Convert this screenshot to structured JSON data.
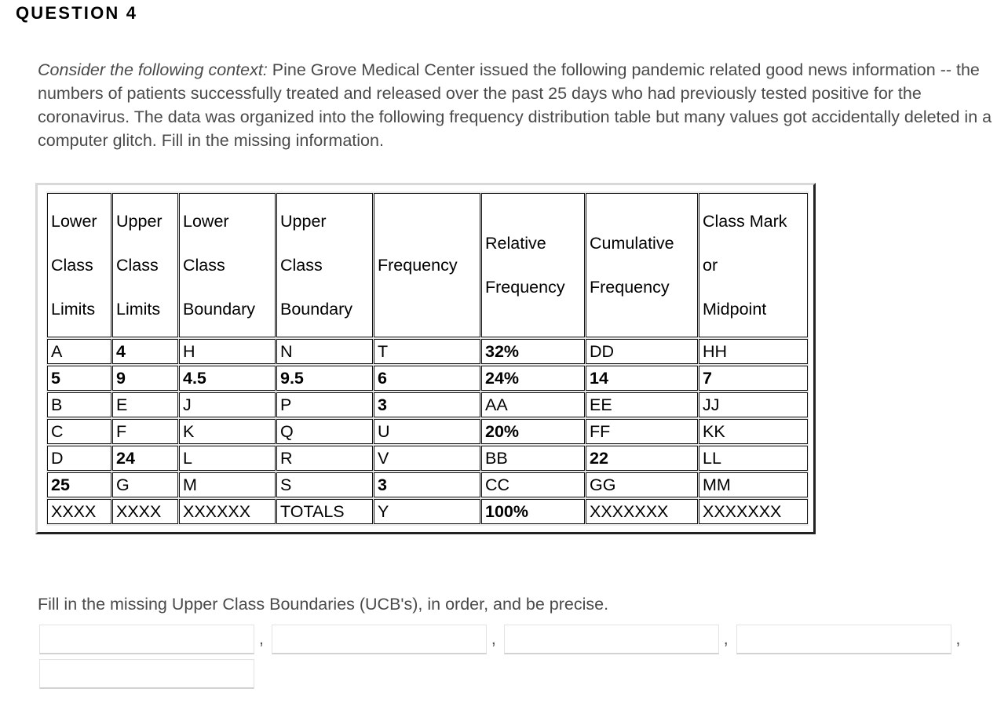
{
  "heading": "QUESTION 4",
  "context": {
    "lead": "Consider the following context:",
    "body": " Pine Grove Medical Center issued the following pandemic related good news information -- the numbers of patients successfully treated and released over the past 25 days who had previously tested positive for the coronavirus.  The data was organized into the following frequency distribution table but many values got accidentally deleted in a computer glitch.  Fill in the missing information."
  },
  "table": {
    "headers": [
      {
        "lines": [
          "Lower",
          "Class",
          "Limits"
        ]
      },
      {
        "lines": [
          "Upper",
          "Class",
          "Limits"
        ]
      },
      {
        "lines": [
          "Lower",
          "Class",
          "Boundary"
        ]
      },
      {
        "lines": [
          "Upper",
          "Class",
          "Boundary"
        ]
      },
      {
        "lines": [
          "Frequency"
        ]
      },
      {
        "lines": [
          "Relative",
          "Frequency"
        ]
      },
      {
        "lines": [
          "Cumulative",
          "Frequency"
        ]
      },
      {
        "lines": [
          "Class Mark",
          "or",
          "Midpoint"
        ]
      }
    ],
    "rows": [
      [
        {
          "v": "A",
          "bold": false
        },
        {
          "v": "4",
          "bold": true
        },
        {
          "v": "H",
          "bold": false
        },
        {
          "v": "N",
          "bold": false
        },
        {
          "v": "T",
          "bold": false
        },
        {
          "v": "32%",
          "bold": true
        },
        {
          "v": "DD",
          "bold": false
        },
        {
          "v": "HH",
          "bold": false
        }
      ],
      [
        {
          "v": "5",
          "bold": true
        },
        {
          "v": "9",
          "bold": true
        },
        {
          "v": "4.5",
          "bold": true
        },
        {
          "v": "9.5",
          "bold": true
        },
        {
          "v": "6",
          "bold": true
        },
        {
          "v": "24%",
          "bold": true
        },
        {
          "v": "14",
          "bold": true
        },
        {
          "v": "7",
          "bold": true
        }
      ],
      [
        {
          "v": "B",
          "bold": false
        },
        {
          "v": "E",
          "bold": false
        },
        {
          "v": "J",
          "bold": false
        },
        {
          "v": "P",
          "bold": false
        },
        {
          "v": "3",
          "bold": true
        },
        {
          "v": "AA",
          "bold": false
        },
        {
          "v": "EE",
          "bold": false
        },
        {
          "v": "JJ",
          "bold": false
        }
      ],
      [
        {
          "v": "C",
          "bold": false
        },
        {
          "v": "F",
          "bold": false
        },
        {
          "v": "K",
          "bold": false
        },
        {
          "v": "Q",
          "bold": false
        },
        {
          "v": "U",
          "bold": false
        },
        {
          "v": "20%",
          "bold": true
        },
        {
          "v": "FF",
          "bold": false
        },
        {
          "v": "KK",
          "bold": false
        }
      ],
      [
        {
          "v": "D",
          "bold": false
        },
        {
          "v": "24",
          "bold": true
        },
        {
          "v": "L",
          "bold": false
        },
        {
          "v": "R",
          "bold": false
        },
        {
          "v": "V",
          "bold": false
        },
        {
          "v": "BB",
          "bold": false
        },
        {
          "v": "22",
          "bold": true
        },
        {
          "v": "LL",
          "bold": false
        }
      ],
      [
        {
          "v": "25",
          "bold": true
        },
        {
          "v": "G",
          "bold": false
        },
        {
          "v": "M",
          "bold": false
        },
        {
          "v": "S",
          "bold": false
        },
        {
          "v": "3",
          "bold": true
        },
        {
          "v": "CC",
          "bold": false
        },
        {
          "v": "GG",
          "bold": false
        },
        {
          "v": "MM",
          "bold": false
        }
      ],
      [
        {
          "v": "XXXX",
          "bold": false
        },
        {
          "v": "XXXX",
          "bold": false
        },
        {
          "v": "XXXXXX",
          "bold": false
        },
        {
          "v": "TOTALS",
          "bold": false
        },
        {
          "v": "Y",
          "bold": false
        },
        {
          "v": "100%",
          "bold": true
        },
        {
          "v": "XXXXXXX",
          "bold": false
        },
        {
          "v": "XXXXXXX",
          "bold": false
        }
      ]
    ]
  },
  "prompt": "Fill in the missing Upper Class Boundaries (UCB's), in order, and be precise.",
  "answers": {
    "separator": ",",
    "fields": [
      {
        "value": "",
        "placeholder": ""
      },
      {
        "value": "",
        "placeholder": ""
      },
      {
        "value": "",
        "placeholder": ""
      },
      {
        "value": "",
        "placeholder": ""
      },
      {
        "value": "",
        "placeholder": ""
      }
    ]
  },
  "colors": {
    "text": "#4a4a4a",
    "table_text": "#000000",
    "frame_light": "#d8d8d8",
    "frame_dark": "#222222",
    "input_border": "#e3e3e3"
  }
}
